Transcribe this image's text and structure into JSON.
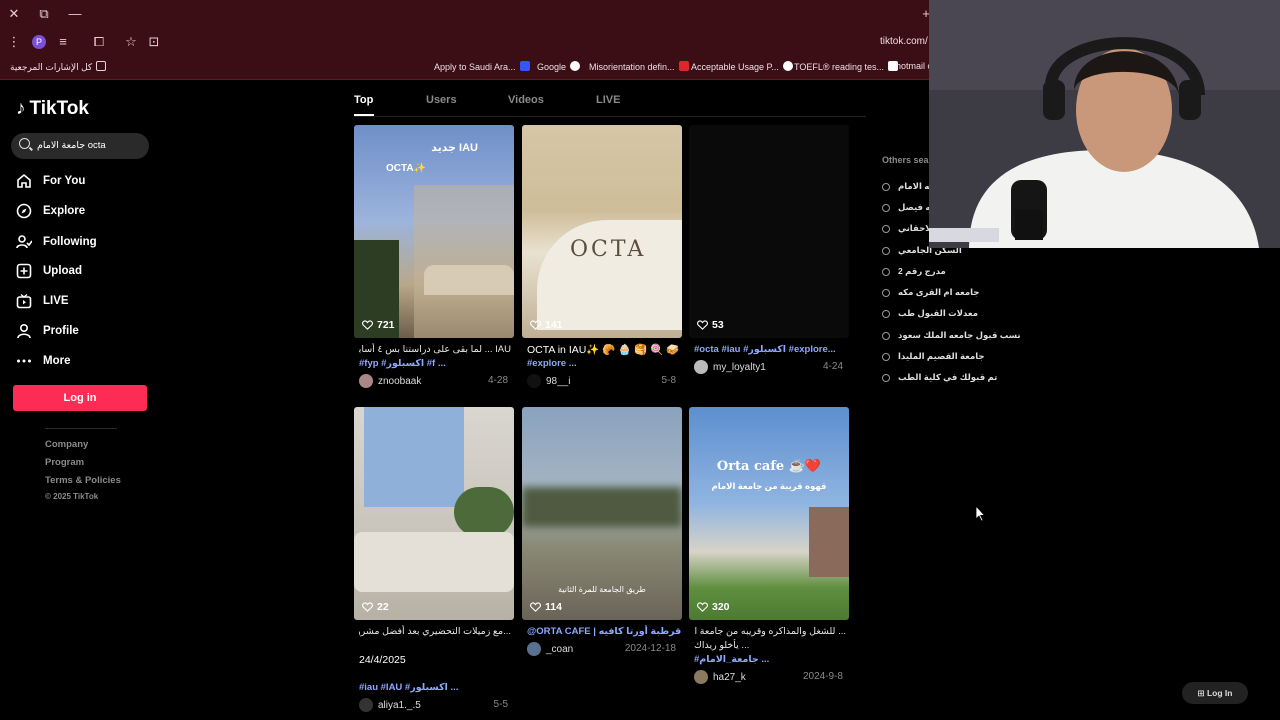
{
  "browser": {
    "url": "tiktok.com/",
    "profile_initial": "P",
    "bookmarks": [
      {
        "label": "كل الإشارات المرجعية",
        "color": "#e8d0d3"
      },
      {
        "label": "Apply to Saudi Ara...",
        "color": "#3355ff"
      },
      {
        "label": "Google",
        "color": "#ffffff"
      },
      {
        "label": "Misorientation defin...",
        "color": "#e0252b"
      },
      {
        "label": "Acceptable Usage P...",
        "color": "#ffffff"
      },
      {
        "label": "TOEFL® reading tes...",
        "color": "#ffffff"
      },
      {
        "label": "hotmail c",
        "color": "#ffffff"
      }
    ]
  },
  "brand": {
    "name": "TikTok"
  },
  "search": {
    "query": "جامعة الامام octa"
  },
  "nav": {
    "items": [
      {
        "label": "For You",
        "icon": "home-icon"
      },
      {
        "label": "Explore",
        "icon": "compass-icon"
      },
      {
        "label": "Following",
        "icon": "following-icon"
      },
      {
        "label": "Upload",
        "icon": "upload-icon"
      },
      {
        "label": "LIVE",
        "icon": "live-icon"
      },
      {
        "label": "Profile",
        "icon": "profile-icon"
      },
      {
        "label": "More",
        "icon": "more-icon"
      }
    ],
    "login_label": "Log in",
    "footer": [
      "Company",
      "Program",
      "Terms & Policies"
    ],
    "copyright": "© 2025 TikTok"
  },
  "tabs": [
    "Top",
    "Users",
    "Videos",
    "LIVE"
  ],
  "videos": [
    {
      "likes": "721",
      "desc1": "IAU ... لما بقى على دراستنا بس ٤ أسابيع",
      "desc2": "#fyp #اكسبلور #f ...",
      "author": "znoobaak",
      "date": "4-28",
      "thumb_text1": "جديد IAU",
      "thumb_text2": "OCTA✨"
    },
    {
      "likes": "141",
      "desc1": "OCTA in IAU✨ 🥐 🧁 🥞 🍭 🥪",
      "desc2": "#explore ...",
      "author": "98__i",
      "date": "5-8",
      "thumb_text1": "OCTA",
      "thumb_text2": ""
    },
    {
      "likes": "53",
      "desc1": "#octa #iau #اكسبلور #explore...",
      "desc2": "",
      "author": "my_loyalty1",
      "date": "4-24",
      "thumb_text1": "",
      "thumb_text2": ""
    },
    {
      "likes": "22",
      "desc1": "...مع زميلات التحضيري بعد أفضل مشروع",
      "desc2": "24/4/2025",
      "desc3": "#iau #IAU #اكسبلور ...",
      "author": "aliya1._.5",
      "date": "5-5",
      "thumb_text1": "",
      "thumb_text2": ""
    },
    {
      "likes": "114",
      "desc1": "@ORTA CAFE | قرطبة أورتا كافيه ...",
      "desc2": "",
      "author": "_coan",
      "date": "2024-12-18",
      "thumb_text1": "طريق الجامعة للمرة الثانية",
      "thumb_text2": ""
    },
    {
      "likes": "320",
      "desc1": "... للشغل والمذاكره وقريبه من جامعة الامام",
      "desc2": "... يأخلو ريداك",
      "desc3": "#جامعة_الامام ...",
      "author": "ha27_k",
      "date": "2024-9-8",
      "thumb_text1": "Orta cafe ☕️❤️",
      "thumb_text2": "قهوه قريبة من جامعة الامام"
    }
  ],
  "others": {
    "title": "Others sea",
    "items": [
      "جامعه الامام",
      "جامعه فيصل",
      "الاحقاني",
      "السكن الجامعي",
      "مدرج رقم 2",
      "جامعه ام القرى مكه",
      "معدلات القبول طب",
      "نسب قبول جامعه الملك سعود",
      "جامعة القصيم المليدا",
      "تم قبولك في كلية الطب"
    ]
  },
  "floating_login": "Log In"
}
